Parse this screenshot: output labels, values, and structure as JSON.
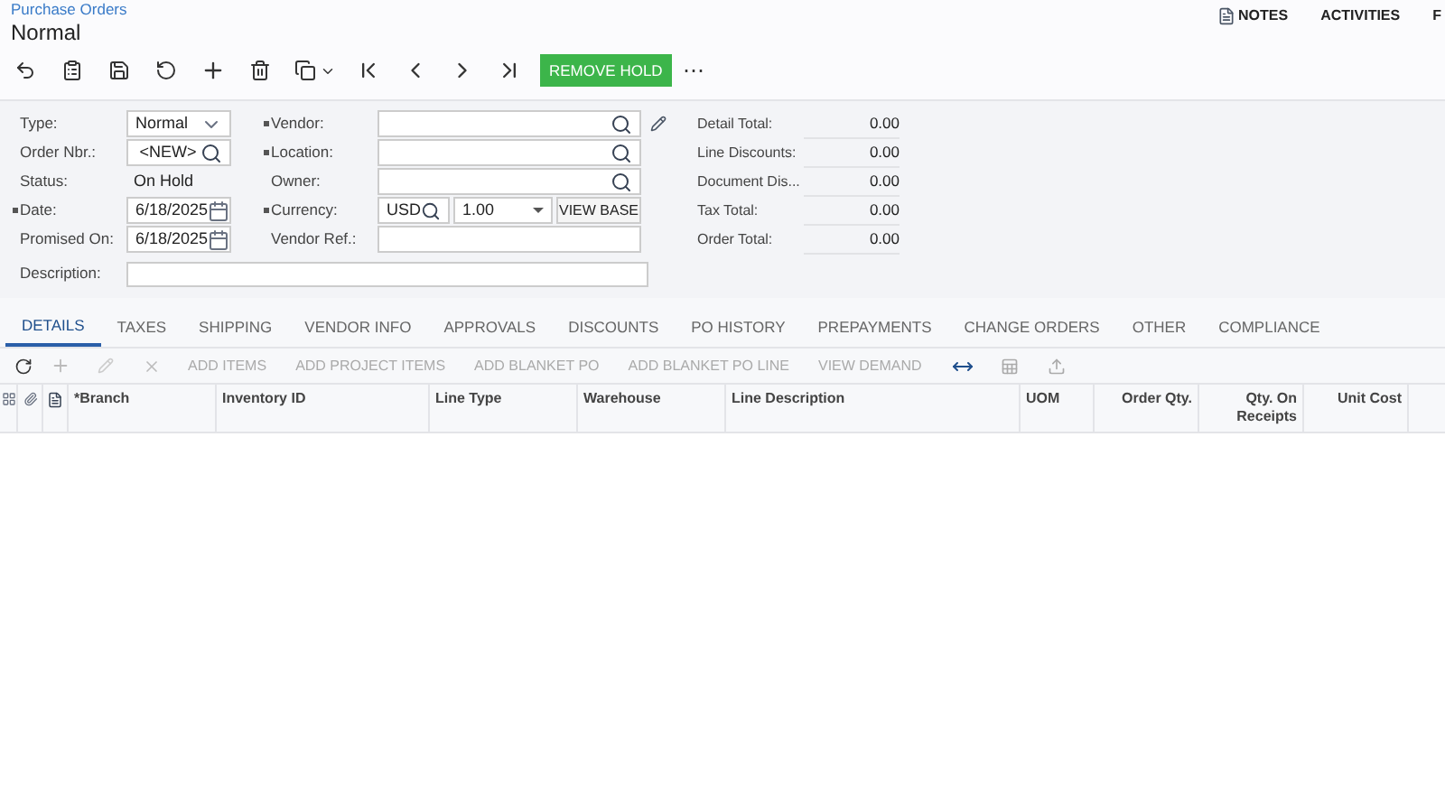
{
  "breadcrumb": "Purchase Orders",
  "title": "Normal",
  "top_links": [
    {
      "label": "NOTES",
      "kind": "notes"
    },
    {
      "label": "ACTIVITIES",
      "kind": "plain"
    },
    {
      "label": "F",
      "kind": "plain"
    }
  ],
  "toolbar": {
    "primary_button": "REMOVE HOLD",
    "more": "⋯"
  },
  "form": {
    "left": [
      {
        "label": "Type:",
        "required": false,
        "kind": "select",
        "value": "Normal"
      },
      {
        "label": "Order Nbr.:",
        "required": false,
        "kind": "lookup",
        "value": "<NEW>"
      },
      {
        "label": "Status:",
        "required": false,
        "kind": "static",
        "value": "On Hold"
      },
      {
        "label": "Date:",
        "required": true,
        "kind": "date",
        "value": "6/18/2025"
      },
      {
        "label": "Promised On:",
        "required": false,
        "kind": "date",
        "value": "6/18/2025"
      }
    ],
    "middle": [
      {
        "label": "Vendor:",
        "required": true,
        "kind": "lookup"
      },
      {
        "label": "Location:",
        "required": true,
        "kind": "lookup"
      },
      {
        "label": "Owner:",
        "required": false,
        "kind": "lookup"
      },
      {
        "label": "Currency:",
        "required": true,
        "kind": "currency",
        "value": "USD",
        "rate": "1.00",
        "button": "VIEW BASE"
      },
      {
        "label": "Vendor Ref.:",
        "required": false,
        "kind": "text"
      }
    ],
    "description": {
      "label": "Description:"
    },
    "totals": [
      {
        "label": "Detail Total:",
        "value": "0.00"
      },
      {
        "label": "Line Discounts:",
        "value": "0.00"
      },
      {
        "label": "Document Dis...",
        "value": "0.00"
      },
      {
        "label": "Tax Total:",
        "value": "0.00"
      },
      {
        "label": "Order Total:",
        "value": "0.00"
      }
    ]
  },
  "tabs": [
    {
      "label": "DETAILS",
      "selected": true
    },
    {
      "label": "TAXES",
      "selected": false
    },
    {
      "label": "SHIPPING",
      "selected": false
    },
    {
      "label": "VENDOR INFO",
      "selected": false
    },
    {
      "label": "APPROVALS",
      "selected": false
    },
    {
      "label": "DISCOUNTS",
      "selected": false
    },
    {
      "label": "PO HISTORY",
      "selected": false
    },
    {
      "label": "PREPAYMENTS",
      "selected": false
    },
    {
      "label": "CHANGE ORDERS",
      "selected": false
    },
    {
      "label": "OTHER",
      "selected": false
    },
    {
      "label": "COMPLIANCE",
      "selected": false
    }
  ],
  "grid_actions": [
    {
      "label": "ADD ITEMS",
      "disabled": true
    },
    {
      "label": "ADD PROJECT ITEMS",
      "disabled": true
    },
    {
      "label": "ADD BLANKET PO",
      "disabled": true
    },
    {
      "label": "ADD BLANKET PO LINE",
      "disabled": true
    },
    {
      "label": "VIEW DEMAND",
      "disabled": true
    }
  ],
  "columns": [
    {
      "label": "*Branch",
      "kind": "text"
    },
    {
      "label": "Inventory ID",
      "kind": "text"
    },
    {
      "label": "Line Type",
      "kind": "text"
    },
    {
      "label": "Warehouse",
      "kind": "text"
    },
    {
      "label": "Line Description",
      "kind": "text"
    },
    {
      "label": "UOM",
      "kind": "text"
    },
    {
      "label": "Order Qty.",
      "kind": "number"
    },
    {
      "label": "Qty. On Receipts",
      "kind": "number"
    },
    {
      "label": "Unit Cost",
      "kind": "number"
    }
  ]
}
